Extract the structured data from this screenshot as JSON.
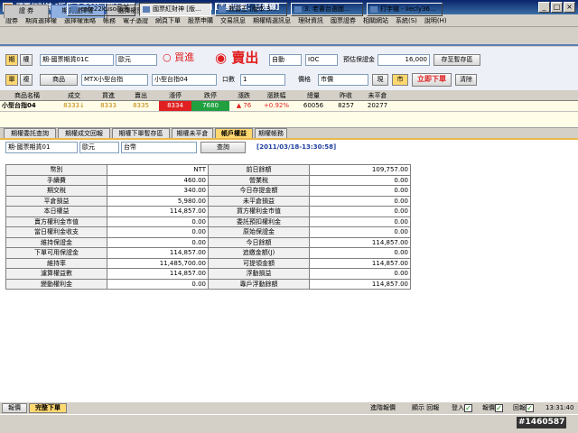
{
  "window": {
    "title": "國票紅財神 [版本 4.20][已登入][帳戶權益] [報價：已連線] [主動回報：已連線]",
    "min": "_",
    "max": "□",
    "close": "×"
  },
  "menu": [
    "證券",
    "期貨選擇權",
    "選擇權策略",
    "帳務",
    "電子憑證",
    "網頁下單",
    "股票申購",
    "交易訊息",
    "期權精選訊息",
    "理財資訊",
    "國票證券",
    "相關網站",
    "系統(S)",
    "說明(H)"
  ],
  "tabs": [
    "證 券",
    "期貨選擇權",
    "選擇權策略"
  ],
  "order": {
    "qi": "期",
    "quan": "權",
    "account": "期-國票期貨01C",
    "currency": "歐元",
    "buy": "買進",
    "sell": "賣出",
    "order_type": "自動",
    "ioc": "IOC",
    "margin_label": "預估保證金",
    "margin_value": "16,000",
    "save_button": "存至暫存區",
    "dan": "單",
    "fu": "複",
    "product_label": "商品",
    "product": "MTX小型台指",
    "contract": "小型台指04",
    "qty_label": "口數",
    "qty": "1",
    "price_label": "價格",
    "price_type": "市價",
    "spot": "現",
    "market": "市",
    "place_order": "立即下單",
    "clear": "清除"
  },
  "quote": {
    "headers": [
      "商品名稱",
      "成交",
      "買進",
      "賣出",
      "漲停",
      "跌停",
      "漲跌",
      "漲跌幅",
      "總量",
      "昨收",
      "未平倉"
    ],
    "row": [
      "小型台指04",
      "8333↓",
      "8333",
      "8335",
      "8334",
      "7680",
      "▲ 76",
      "+0.92%",
      "60056",
      "8257",
      "20277"
    ]
  },
  "subtabs": [
    "期權委託查詢",
    "期權成交回報",
    "期權下單暫存區",
    "期權未平倉",
    "帳戶權益",
    "期權帳務"
  ],
  "query": {
    "account": "期-國票期貨01",
    "currency": "歐元",
    "base": "台幣",
    "button": "查詢",
    "timestamp": "[2011/03/18-13:30:58]"
  },
  "table": [
    [
      "幣別",
      "NTT",
      "前日餘額",
      "109,757.00"
    ],
    [
      "手續費",
      "460.00",
      "營業稅",
      "0.00"
    ],
    [
      "期交稅",
      "340.00",
      "今日存提金額",
      "0.00"
    ],
    [
      "平倉損益",
      "5,980.00",
      "未平倉損益",
      "0.00"
    ],
    [
      "本日權益",
      "114,857.00",
      "買方權利金市值",
      "0.00"
    ],
    [
      "賣方權利金市值",
      "0.00",
      "委託預扣權利金",
      "0.00"
    ],
    [
      "當日權利金收支",
      "0.00",
      "原始保證金",
      "0.00"
    ],
    [
      "維持保證金",
      "0.00",
      "今日餘額",
      "114,857.00"
    ],
    [
      "下單可用保證金",
      "114,857.00",
      "追繳金額(J)",
      "0.00"
    ],
    [
      "維持率",
      "11,485,700.00",
      "可提領金額",
      "114,857.00"
    ],
    [
      "濾算權益數",
      "114,857.00",
      "浮動損益",
      "0.00"
    ],
    [
      "變動權利金",
      "0.00",
      "專戶浮動餘額",
      "114,857.00"
    ]
  ],
  "status": {
    "left1": "報價",
    "left2": "完整下單",
    "reply": "進階報價",
    "show_reply": "顯示 回報",
    "login": "登入",
    "quote": "報價",
    "reply2": "回報",
    "time": "13:31:40"
  },
  "taskbar": [
    "cafe22kuso部落...",
    "國票紅財神 [版...",
    "救富王 [版本 3...",
    "3. 老書台選圖...",
    "打字機 - iiecly36...",
    "#1460587"
  ],
  "colors": {
    "titlebar": "#0a246a",
    "buy": "#e02020",
    "sell": "#e02020",
    "limit_up": "#e02020",
    "limit_down": "#20a040"
  }
}
